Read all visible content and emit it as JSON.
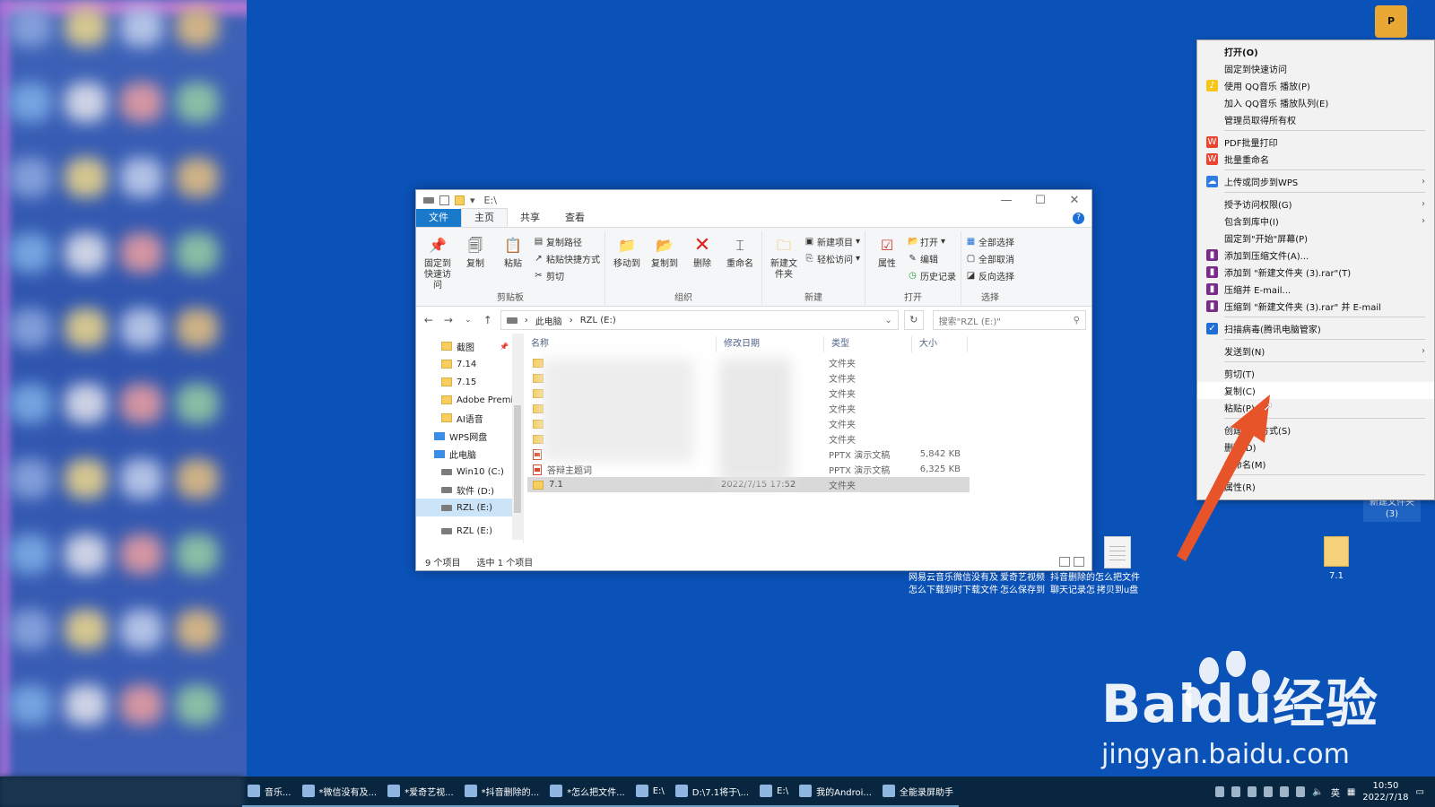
{
  "explorer": {
    "title_path": "E:\\",
    "tabs": [
      "文件",
      "主页",
      "共享",
      "查看"
    ],
    "ribbon": {
      "clipboard": {
        "pin": "固定到快速访问",
        "copy": "复制",
        "paste": "粘贴",
        "copy_path": "复制路径",
        "paste_shortcut": "粘贴快捷方式",
        "cut": "剪切",
        "label": "剪贴板"
      },
      "organize": {
        "move_to": "移动到",
        "copy_to": "复制到",
        "delete": "删除",
        "rename": "重命名",
        "label": "组织"
      },
      "new": {
        "new_folder": "新建文件夹",
        "new_item": "新建项目",
        "easy_access": "轻松访问",
        "label": "新建"
      },
      "open": {
        "properties": "属性",
        "open": "打开",
        "edit": "编辑",
        "history": "历史记录",
        "label": "打开"
      },
      "select": {
        "select_all": "全部选择",
        "select_none": "全部取消",
        "invert": "反向选择",
        "label": "选择"
      }
    },
    "address": {
      "pc": "此电脑",
      "drive": "RZL (E:)"
    },
    "search_placeholder": "搜索\"RZL (E:)\"",
    "nav": [
      {
        "label": "截图",
        "kind": "folder"
      },
      {
        "label": "7.14",
        "kind": "folder"
      },
      {
        "label": "7.15",
        "kind": "folder"
      },
      {
        "label": "Adobe Premier",
        "kind": "folder"
      },
      {
        "label": "AI语音",
        "kind": "folder"
      },
      {
        "label": "WPS网盘",
        "kind": "cloud"
      },
      {
        "label": "此电脑",
        "kind": "pc"
      },
      {
        "label": "Win10 (C:)",
        "kind": "drive"
      },
      {
        "label": "软件 (D:)",
        "kind": "drive"
      },
      {
        "label": "RZL (E:)",
        "kind": "drive"
      },
      {
        "label": "RZL (E:)",
        "kind": "drive"
      }
    ],
    "columns": [
      "名称",
      "修改日期",
      "类型",
      "大小"
    ],
    "files": [
      {
        "name": "",
        "date": "",
        "type": "文件夹",
        "size": "",
        "icon": "folder"
      },
      {
        "name": "",
        "date": "",
        "type": "文件夹",
        "size": "",
        "icon": "folder"
      },
      {
        "name": "",
        "date": "",
        "type": "文件夹",
        "size": "",
        "icon": "folder"
      },
      {
        "name": "",
        "date": "",
        "type": "文件夹",
        "size": "",
        "icon": "folder"
      },
      {
        "name": "",
        "date": "",
        "type": "文件夹",
        "size": "",
        "icon": "folder"
      },
      {
        "name": "",
        "date": "",
        "type": "文件夹",
        "size": "",
        "icon": "folder"
      },
      {
        "name": "",
        "date": "",
        "type": "PPTX 演示文稿",
        "size": "5,842 KB",
        "icon": "pptx"
      },
      {
        "name": "答辩主题词",
        "date": "",
        "type": "PPTX 演示文稿",
        "size": "6,325 KB",
        "icon": "pptx"
      },
      {
        "name": "7.1",
        "date": "2022/7/15 17:52",
        "type": "文件夹",
        "size": "",
        "icon": "folder"
      }
    ],
    "status": {
      "count": "9 个项目",
      "selected": "选中 1 个项目"
    }
  },
  "context_menu": [
    {
      "label": "打开(O)",
      "bold": true
    },
    {
      "label": "固定到快速访问"
    },
    {
      "label": "使用 QQ音乐 播放(P)",
      "icon": "qqmusic-icon",
      "color": "#f5c518"
    },
    {
      "label": "加入 QQ音乐 播放队列(E)"
    },
    {
      "label": "管理员取得所有权"
    },
    {
      "sep": true
    },
    {
      "label": "PDF批量打印",
      "icon": "wps-icon",
      "color": "#e8442f"
    },
    {
      "label": "批量重命名",
      "icon": "wps-icon",
      "color": "#e8442f"
    },
    {
      "sep": true
    },
    {
      "label": "上传或同步到WPS",
      "icon": "cloud-icon",
      "color": "#2f7de1",
      "arrow": true
    },
    {
      "sep": true
    },
    {
      "label": "授予访问权限(G)",
      "arrow": true
    },
    {
      "label": "包含到库中(I)",
      "arrow": true
    },
    {
      "label": "固定到\"开始\"屏幕(P)"
    },
    {
      "label": "添加到压缩文件(A)...",
      "icon": "winrar-icon",
      "color": "#7a2a8a"
    },
    {
      "label": "添加到 \"新建文件夹 (3).rar\"(T)",
      "icon": "winrar-icon",
      "color": "#7a2a8a"
    },
    {
      "label": "压缩并 E-mail...",
      "icon": "winrar-icon",
      "color": "#7a2a8a"
    },
    {
      "label": "压缩到 \"新建文件夹 (3).rar\" 并 E-mail",
      "icon": "winrar-icon",
      "color": "#7a2a8a"
    },
    {
      "sep": true
    },
    {
      "label": "扫描病毒(腾讯电脑管家)",
      "icon": "shield-icon",
      "color": "#1d6fd6"
    },
    {
      "sep": true
    },
    {
      "label": "发送到(N)",
      "arrow": true
    },
    {
      "sep": true
    },
    {
      "label": "剪切(T)"
    },
    {
      "label": "复制(C)",
      "highlight": true
    },
    {
      "label": "粘贴(P)"
    },
    {
      "sep": true
    },
    {
      "label": "创建快捷方式(S)"
    },
    {
      "label": "删除(D)"
    },
    {
      "label": "重命名(M)"
    },
    {
      "sep": true
    },
    {
      "label": "属性(R)"
    }
  ],
  "desktop": {
    "icons": [
      {
        "label": "网易云音乐怎么下载到u盘",
        "kind": "doc"
      },
      {
        "label": "微信没有及时下载文件已...",
        "kind": "doc"
      },
      {
        "label": "爱奇艺视频怎么保存到手...",
        "kind": "doc"
      },
      {
        "label": "抖音删除的聊天记录怎么...",
        "kind": "doc"
      },
      {
        "label": "怎么把文件拷贝到u盘",
        "kind": "doc"
      },
      {
        "label": "7.1",
        "kind": "folder"
      }
    ],
    "new_folder_label": "新建文件夹 (3)",
    "watermark_brand": "Baidu经验",
    "watermark_url": "jingyan.baidu.com"
  },
  "taskbar": {
    "items": [
      "音乐...",
      "*微信没有及...",
      "*爱奇艺视...",
      "*抖音删除的...",
      "*怎么把文件...",
      "E:\\",
      "D:\\7.1将于\\...",
      "E:\\",
      "我的Androi...",
      "全能录屏助手"
    ],
    "ime": "英",
    "time": "10:50",
    "date": "2022/7/18"
  },
  "colors": {
    "desktop": "#0a52b8",
    "accent": "#1979ca",
    "arrow": "#e8542a"
  }
}
